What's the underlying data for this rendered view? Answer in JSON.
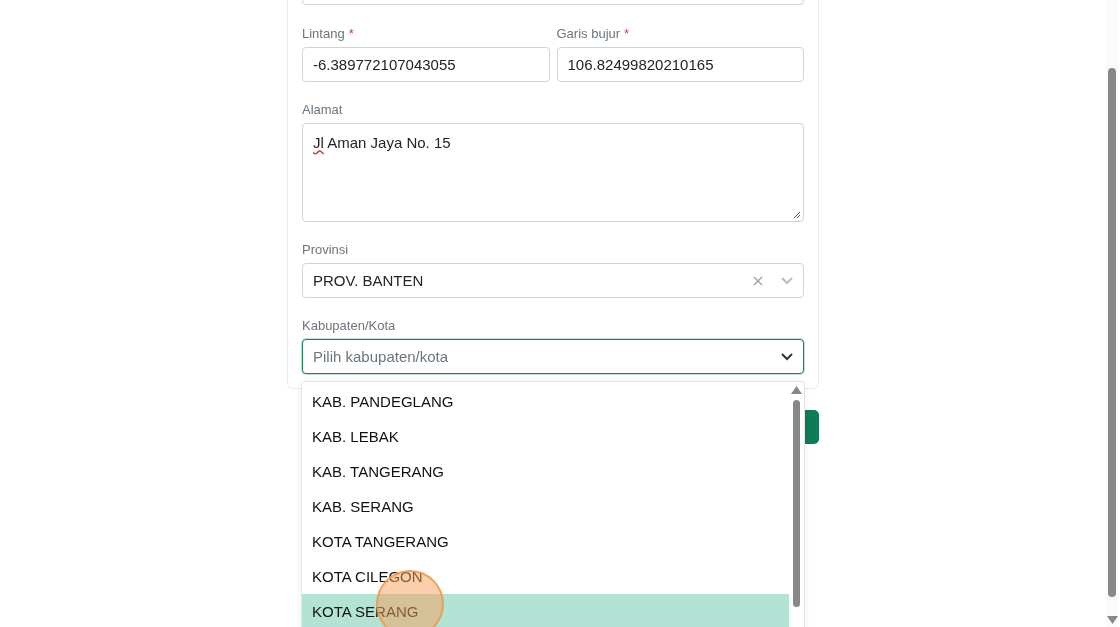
{
  "fields": [
    {
      "label": "Lintang",
      "required_mark": "*",
      "value": "-6.389772107043055"
    },
    {
      "label": "Garis bujur",
      "required_mark": "*",
      "value": "106.82499820210165"
    }
  ],
  "address": {
    "label": "Alamat",
    "value": "Jl Aman Jaya No. 15"
  },
  "selects": [
    {
      "label": "Provinsi",
      "value": "PROV. BANTEN",
      "clearable": true,
      "focused": false
    },
    {
      "label": "Kabupaten/Kota",
      "placeholder": "Pilih kabupaten/kota",
      "clearable": false,
      "focused": true
    }
  ],
  "dropdown": {
    "options": [
      {
        "label": "KAB. PANDEGLANG",
        "selected": false
      },
      {
        "label": "KAB. LEBAK",
        "selected": false
      },
      {
        "label": "KAB. TANGERANG",
        "selected": false
      },
      {
        "label": "KAB. SERANG",
        "selected": false
      },
      {
        "label": "KOTA TANGERANG",
        "selected": false
      },
      {
        "label": "KOTA CILEGON",
        "selected": false
      },
      {
        "label": "KOTA SERANG",
        "selected": true
      }
    ]
  }
}
